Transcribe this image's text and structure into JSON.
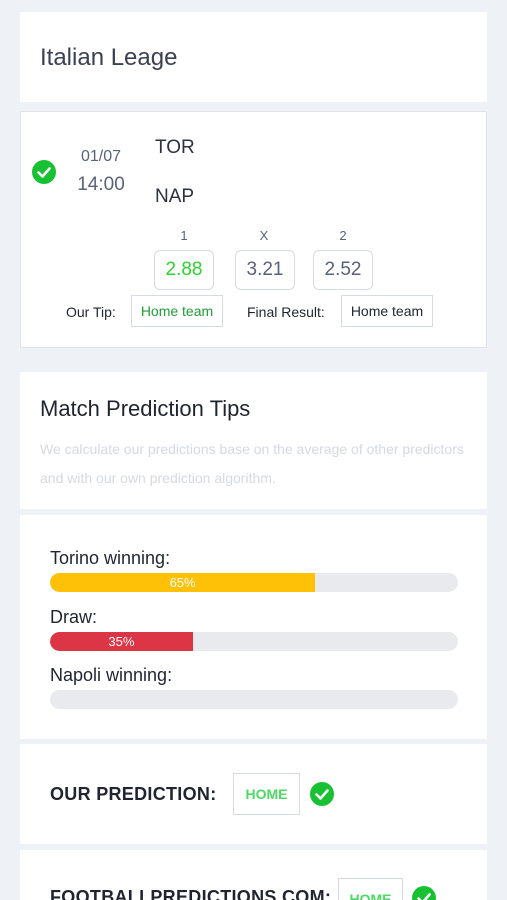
{
  "league": {
    "title": "Italian Leage"
  },
  "match": {
    "date": "01/07",
    "time": "14:00",
    "home_team": "TOR",
    "away_team": "NAP",
    "odds": [
      {
        "label": "1",
        "value": "2.88",
        "highlight": true
      },
      {
        "label": "X",
        "value": "3.21",
        "highlight": false
      },
      {
        "label": "2",
        "value": "2.52",
        "highlight": false
      }
    ],
    "tip_label": "Our Tip:",
    "tip_value": "Home team",
    "result_label": "Final Result:",
    "result_value": "Home team",
    "status_icon": "check-circle-icon"
  },
  "tips": {
    "title": "Match Prediction Tips",
    "description": "We calculate our predictions base on the average of other predictors and with our own prediction algorithm."
  },
  "probabilities": [
    {
      "label": "Torino winning:",
      "percent": 65,
      "percent_text": "65%",
      "color": "#ffc107"
    },
    {
      "label": "Draw:",
      "percent": 35,
      "percent_text": "35%",
      "color": "#dc3545"
    },
    {
      "label": "Napoli winning:",
      "percent": 0,
      "percent_text": "",
      "color": "#28a745"
    }
  ],
  "our_prediction": {
    "label": "OUR PREDICTION:",
    "value": "HOME",
    "status_icon": "check-circle-icon"
  },
  "external_prediction": {
    "label": "FOOTBALLPREDICTIONS.COM:",
    "value": "HOME",
    "status_icon": "check-circle-icon"
  },
  "colors": {
    "accent_green": "#17c131",
    "odd_win": "#2bd42b",
    "chip_green": "#4cd964",
    "background": "#eef1f6"
  }
}
